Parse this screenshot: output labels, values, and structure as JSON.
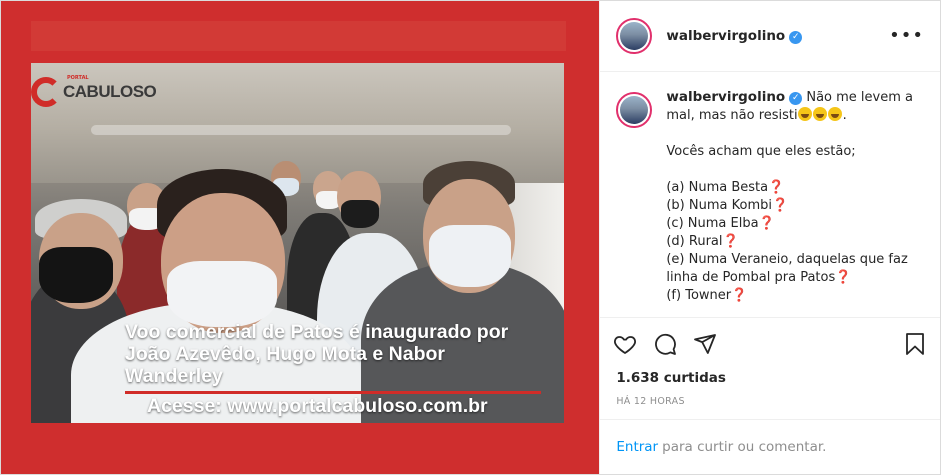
{
  "post": {
    "media": {
      "logo_text": "CABULOSO",
      "logo_tag": "PORTAL",
      "caption_lines": [
        "Voo comercial de Patos é inaugurado por",
        "João Azevêdo, Hugo Mota e Nabor",
        "Wanderley"
      ],
      "url_text": "Acesse: www.portalcabuloso.com.br"
    },
    "header": {
      "username": "walbervirgolino",
      "verified_glyph": "✓",
      "more_label": "•••"
    },
    "comment": {
      "username": "walbervirgolino",
      "verified_glyph": "✓",
      "intro_1": "Não me levem a",
      "intro_2": "mal, mas não resisti",
      "intro_end": ".",
      "question": "Vocês acham que eles estão;",
      "options": [
        "(a) Numa Besta",
        "(b) Numa Kombi",
        "(c) Numa Elba",
        "(d) Rural",
        "(e) Numa Veraneio, daquelas que faz",
        "linha de Pombal pra Patos",
        "(f) Towner"
      ],
      "qmark": "❓"
    },
    "likes_text": "1.638 curtidas",
    "time_text": "HÁ 12 HORAS",
    "footer": {
      "login_label": "Entrar",
      "rest_text": "para curtir ou comentar."
    },
    "icons": [
      "heart-icon",
      "comment-icon",
      "share-icon",
      "bookmark-icon",
      "verified-icon",
      "more-icon"
    ],
    "colors": {
      "accent_blue": "#0095f6",
      "verified_blue": "#3897f0",
      "brand_red": "#d02c28",
      "text": "#262626",
      "muted": "#8e8e8e"
    }
  }
}
